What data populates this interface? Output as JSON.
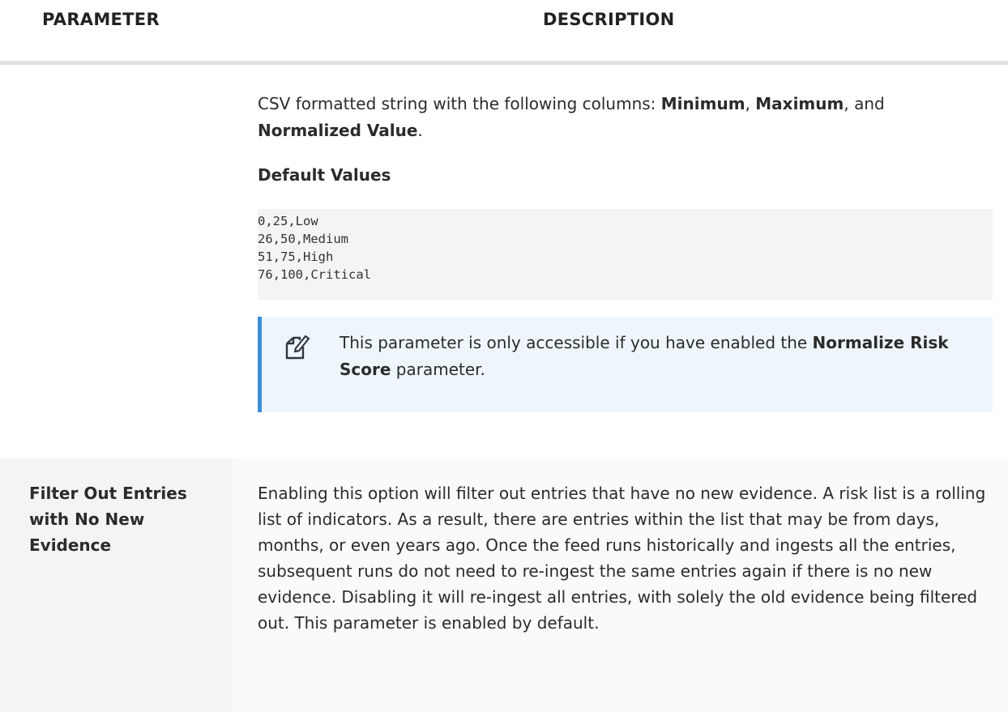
{
  "table": {
    "headers": {
      "parameter": "PARAMETER",
      "description": "DESCRIPTION"
    }
  },
  "row1": {
    "description": {
      "intro_prefix": "CSV formatted string with the following columns: ",
      "col_min": "Minimum",
      "sep1": ", ",
      "col_max": "Maximum",
      "sep2": ", and ",
      "col_norm": "Normalized Value",
      "intro_suffix": ".",
      "default_heading": "Default Values",
      "code_lines": [
        "0,25,Low",
        "26,50,Medium",
        "51,75,High",
        "76,100,Critical"
      ],
      "note": {
        "icon": "note-pencil-icon",
        "text_prefix": "This parameter is only accessible if you have enabled the ",
        "text_bold": "Normalize Risk Score",
        "text_suffix": " parameter."
      }
    }
  },
  "row2": {
    "parameter": "Filter Out Entries with No New Evidence",
    "description": "Enabling this option will filter out entries that have no new evidence. A risk list is a rolling list of indicators. As a result, there are entries within the list that may be from days, months, or even years ago. Once the feed runs historically and ingests all the entries, subsequent runs do not need to re-ingest the same entries again if there is no new evidence. Disabling it will re-ingest all entries, with solely the old evidence being filtered out.  This parameter is enabled by default."
  },
  "colors": {
    "note_border": "#3b8fd8",
    "note_bg": "#eff6fb",
    "header_rule": "#dfe2e6",
    "code_bg": "#f4f4f4"
  }
}
